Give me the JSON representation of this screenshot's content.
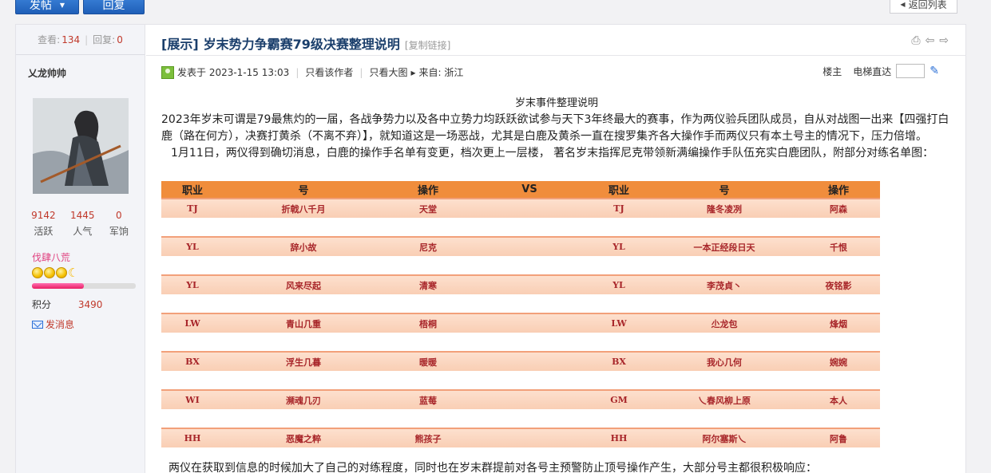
{
  "toolbar": {
    "post_label": "发帖",
    "reply_label": "回复",
    "back_label": "返回列表"
  },
  "sidebar": {
    "views_label": "查看:",
    "views": "134",
    "replies_label": "回复:",
    "replies": "0",
    "username": "乂龙帅帅",
    "stats": [
      {
        "value": "9142",
        "label": "活跃"
      },
      {
        "value": "1445",
        "label": "人气"
      },
      {
        "value": "0",
        "label": "军饷"
      }
    ],
    "rank": "伐肆八荒",
    "progress": 0.5,
    "score_label": "积分",
    "score": "3490",
    "send_message": "发消息"
  },
  "post": {
    "tag": "[展示]",
    "title": "岁末势力争霸赛79级决赛整理说明",
    "copy_link": "[复制链接]",
    "meta": {
      "posted_at": "发表于 2023-1-15 13:03",
      "only_author": "只看该作者",
      "big_image": "只看大图",
      "from": "来自: 浙江"
    },
    "floor": "楼主",
    "jump_label": "电梯直达",
    "content_title": "岁末事件整理说明",
    "para1": "2023年岁末可谓是79最焦灼的一届，各战争势力以及各中立势力均跃跃欲试参与天下3年终最大的赛事，作为两仪验兵团队成员，自从对战图一出来【四强打白鹿（路在何方），决赛打黄杀（不离不弃）】，就知道这是一场恶战，尤其是白鹿及黄杀一直在搜罗集齐各大操作手而两仪只有本土号主的情况下，压力倍增。",
    "para2": "1月11日，两仪得到确切消息，白鹿的操作手名单有变更，档次更上一层楼，  著名岁末指挥尼克带领新满编操作手队伍充实白鹿团队，附部分对练名单图：",
    "footer": "两仪在获取到信息的时候加大了自己的对练程度，同时也在岁末群提前对各号主预警防止顶号操作产生，大部分号主都很积极响应："
  },
  "table": {
    "headers": [
      "职业",
      "号",
      "操作",
      "VS",
      "职业",
      "号",
      "操作"
    ],
    "rows": [
      [
        "TJ",
        "折戟八千月",
        "天堂",
        "",
        "TJ",
        "隆冬凌冽",
        "阿森"
      ],
      [
        "YL",
        "辞小故",
        "尼克",
        "",
        "YL",
        "一本正经段日天",
        "千恨"
      ],
      [
        "YL",
        "风来尽起",
        "清寒",
        "",
        "YL",
        "李茂貞丶",
        "夜铭影"
      ],
      [
        "LW",
        "青山几重",
        "梧桐",
        "",
        "LW",
        "尐龙包",
        "烽烟"
      ],
      [
        "BX",
        "浮生几暮",
        "暖暖",
        "",
        "BX",
        "我心几何",
        "婉婉"
      ],
      [
        "WI",
        "濒魂几刃",
        "蓝莓",
        "",
        "GM",
        "乀春风柳上原",
        "本人"
      ],
      [
        "HH",
        "恶魔之粹",
        "熊孩子",
        "",
        "HH",
        "阿尔塞斯乀",
        "阿鲁"
      ]
    ]
  }
}
